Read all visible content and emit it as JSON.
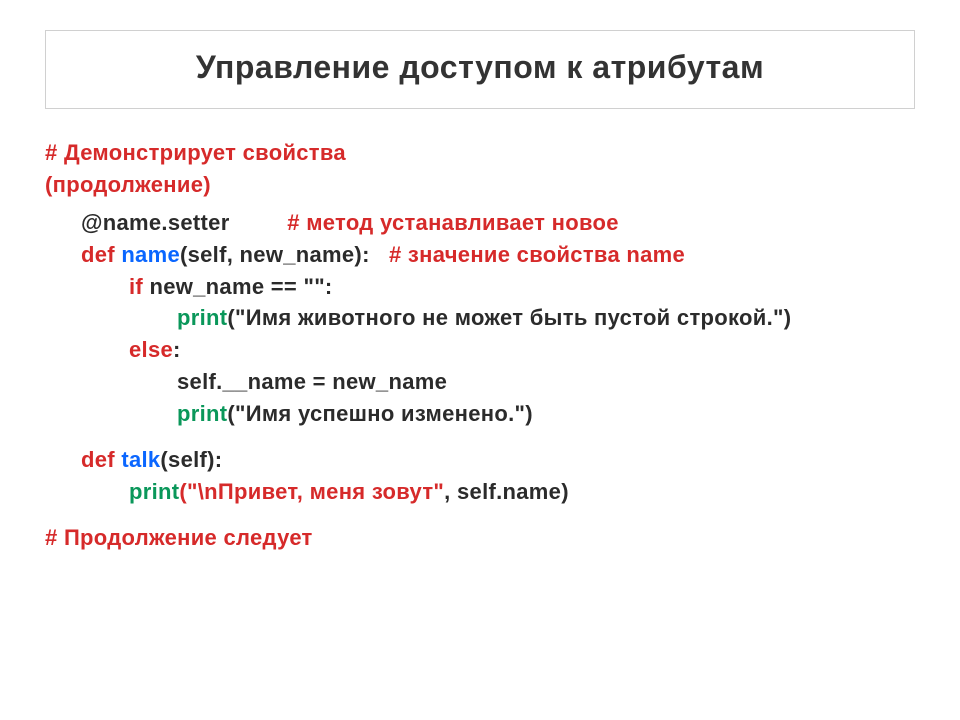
{
  "title": "Управление доступом к атрибутам",
  "lines": {
    "l1": "# Демонстрирует свойства",
    "l2": "(продолжение)",
    "decorator": "@name.setter",
    "decoratorComment": "# метод устанавливает новое",
    "defKw1": "def ",
    "defName1": "name",
    "defArgs1": "(self, new_name):",
    "defComment1": "# значение свойства name",
    "ifKw": "if",
    "ifCond": " new_name == \"\":",
    "print1": "print",
    "print1Args": "(\"Имя животного не может быть пустой строкой.\")",
    "elseKw": "else",
    "elseColon": ":",
    "assignLine": "self.__name = new_name",
    "print2": "print",
    "print2Args": "(\"Имя успешно изменено.\")",
    "defKw2": "def ",
    "defName2": "talk",
    "defArgs2": "(self):",
    "print3": "print",
    "print3ArgA": "(\"\\nПривет, меня зовут\"",
    "print3ArgB": ", self.name)",
    "footer": "# Продолжение следует"
  }
}
